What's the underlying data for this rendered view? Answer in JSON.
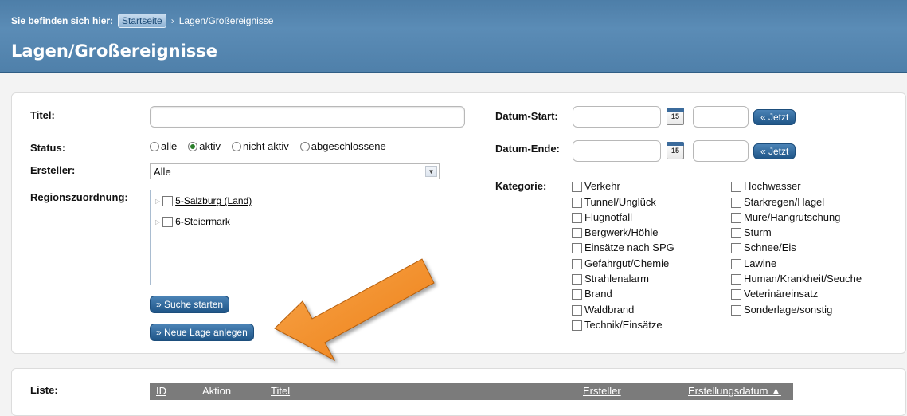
{
  "breadcrumb": {
    "label": "Sie befinden sich hier:",
    "home": "Startseite",
    "sep": "›",
    "current": "Lagen/Großereignisse"
  },
  "page_title": "Lagen/Großereignisse",
  "form": {
    "titel_label": "Titel:",
    "status_label": "Status:",
    "status_options": [
      "alle",
      "aktiv",
      "nicht aktiv",
      "abgeschlossene"
    ],
    "status_selected": "aktiv",
    "ersteller_label": "Ersteller:",
    "ersteller_value": "Alle",
    "regions_label": "Regionszuordnung:",
    "regions": [
      "5-Salzburg (Land)",
      "6-Steiermark"
    ],
    "search_button": "» Suche starten",
    "new_button": "» Neue Lage anlegen",
    "datum_start_label": "Datum-Start:",
    "datum_ende_label": "Datum-Ende:",
    "jetzt_button": "« Jetzt",
    "calendar_day": "15",
    "kategorie_label": "Kategorie:",
    "kategorien_col1": [
      "Verkehr",
      "Tunnel/Unglück",
      "Flugnotfall",
      "Bergwerk/Höhle",
      "Einsätze nach SPG",
      "Gefahrgut/Chemie",
      "Strahlenalarm",
      "Brand",
      "Waldbrand",
      "Technik/Einsätze"
    ],
    "kategorien_col2": [
      "Hochwasser",
      "Starkregen/Hagel",
      "Mure/Hangrutschung",
      "Sturm",
      "Schnee/Eis",
      "Lawine",
      "Human/Krankheit/Seuche",
      "Veterinäreinsatz",
      "Sonderlage/sonstig"
    ]
  },
  "list": {
    "label": "Liste:",
    "columns": [
      "ID",
      "Aktion",
      "Titel",
      "Ersteller",
      "Erstellungsdatum ▲"
    ]
  },
  "colors": {
    "header": "#4f80aa",
    "button": "#2a6296",
    "arrow": "#f28c28"
  },
  "icons": {
    "calendar": "calendar-icon",
    "arrow": "orange-arrow"
  }
}
